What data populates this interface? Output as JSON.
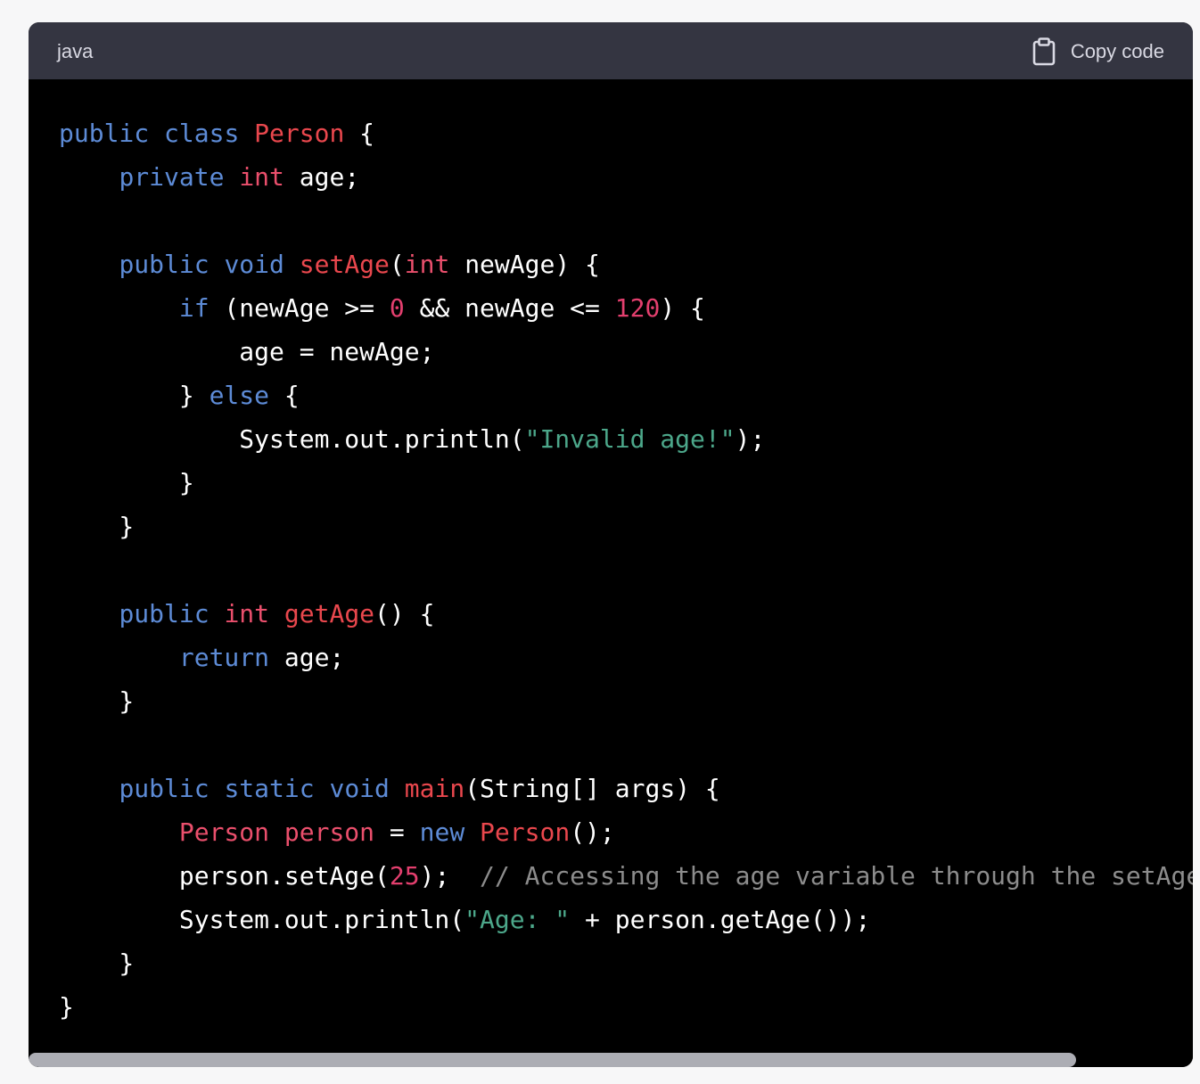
{
  "header": {
    "language": "java",
    "copy_label": "Copy code",
    "copy_icon": "clipboard-icon"
  },
  "colors": {
    "background": "#f7f7f8",
    "code_background": "#000000",
    "header_background": "#343541",
    "keyword": "#5d8bd6",
    "type": "#ea4f6c",
    "number": "#e33f6e",
    "string": "#4ca78a",
    "comment": "#8c8c8c"
  },
  "code": {
    "lines": [
      [
        [
          "kw",
          "public"
        ],
        [
          "p",
          " "
        ],
        [
          "kw",
          "class"
        ],
        [
          "p",
          " "
        ],
        [
          "fn",
          "Person"
        ],
        [
          "p",
          " {"
        ]
      ],
      [
        [
          "p",
          "    "
        ],
        [
          "kw",
          "private"
        ],
        [
          "p",
          " "
        ],
        [
          "typ",
          "int"
        ],
        [
          "p",
          " age;"
        ]
      ],
      [
        [
          "p",
          ""
        ]
      ],
      [
        [
          "p",
          "    "
        ],
        [
          "kw",
          "public"
        ],
        [
          "p",
          " "
        ],
        [
          "kw",
          "void"
        ],
        [
          "p",
          " "
        ],
        [
          "fn",
          "setAge"
        ],
        [
          "p",
          "("
        ],
        [
          "typ",
          "int"
        ],
        [
          "p",
          " newAge) {"
        ]
      ],
      [
        [
          "p",
          "        "
        ],
        [
          "kw",
          "if"
        ],
        [
          "p",
          " (newAge >= "
        ],
        [
          "num",
          "0"
        ],
        [
          "p",
          " && newAge <= "
        ],
        [
          "num",
          "120"
        ],
        [
          "p",
          ") {"
        ]
      ],
      [
        [
          "p",
          "            age = newAge;"
        ]
      ],
      [
        [
          "p",
          "        } "
        ],
        [
          "kw",
          "else"
        ],
        [
          "p",
          " {"
        ]
      ],
      [
        [
          "p",
          "            System.out.println("
        ],
        [
          "str",
          "\"Invalid age!\""
        ],
        [
          "p",
          ");"
        ]
      ],
      [
        [
          "p",
          "        }"
        ]
      ],
      [
        [
          "p",
          "    }"
        ]
      ],
      [
        [
          "p",
          ""
        ]
      ],
      [
        [
          "p",
          "    "
        ],
        [
          "kw",
          "public"
        ],
        [
          "p",
          " "
        ],
        [
          "typ",
          "int"
        ],
        [
          "p",
          " "
        ],
        [
          "fn",
          "getAge"
        ],
        [
          "p",
          "() {"
        ]
      ],
      [
        [
          "p",
          "        "
        ],
        [
          "kw",
          "return"
        ],
        [
          "p",
          " age;"
        ]
      ],
      [
        [
          "p",
          "    }"
        ]
      ],
      [
        [
          "p",
          ""
        ]
      ],
      [
        [
          "p",
          "    "
        ],
        [
          "kw",
          "public"
        ],
        [
          "p",
          " "
        ],
        [
          "kw",
          "static"
        ],
        [
          "p",
          " "
        ],
        [
          "kw",
          "void"
        ],
        [
          "p",
          " "
        ],
        [
          "fn",
          "main"
        ],
        [
          "p",
          "(String[] args) {"
        ]
      ],
      [
        [
          "p",
          "        "
        ],
        [
          "typ",
          "Person"
        ],
        [
          "p",
          " "
        ],
        [
          "typ",
          "person"
        ],
        [
          "p",
          " = "
        ],
        [
          "kw",
          "new"
        ],
        [
          "p",
          " "
        ],
        [
          "fn",
          "Person"
        ],
        [
          "p",
          "();"
        ]
      ],
      [
        [
          "p",
          "        person.setAge("
        ],
        [
          "num",
          "25"
        ],
        [
          "p",
          ");  "
        ],
        [
          "com",
          "// Accessing the age variable through the setAge"
        ]
      ],
      [
        [
          "p",
          "        System.out.println("
        ],
        [
          "str",
          "\"Age: \""
        ],
        [
          "p",
          " + person.getAge());"
        ]
      ],
      [
        [
          "p",
          "    }"
        ]
      ],
      [
        [
          "p",
          "}"
        ]
      ]
    ]
  },
  "scrollbar": {
    "visible_fraction": 0.9
  }
}
